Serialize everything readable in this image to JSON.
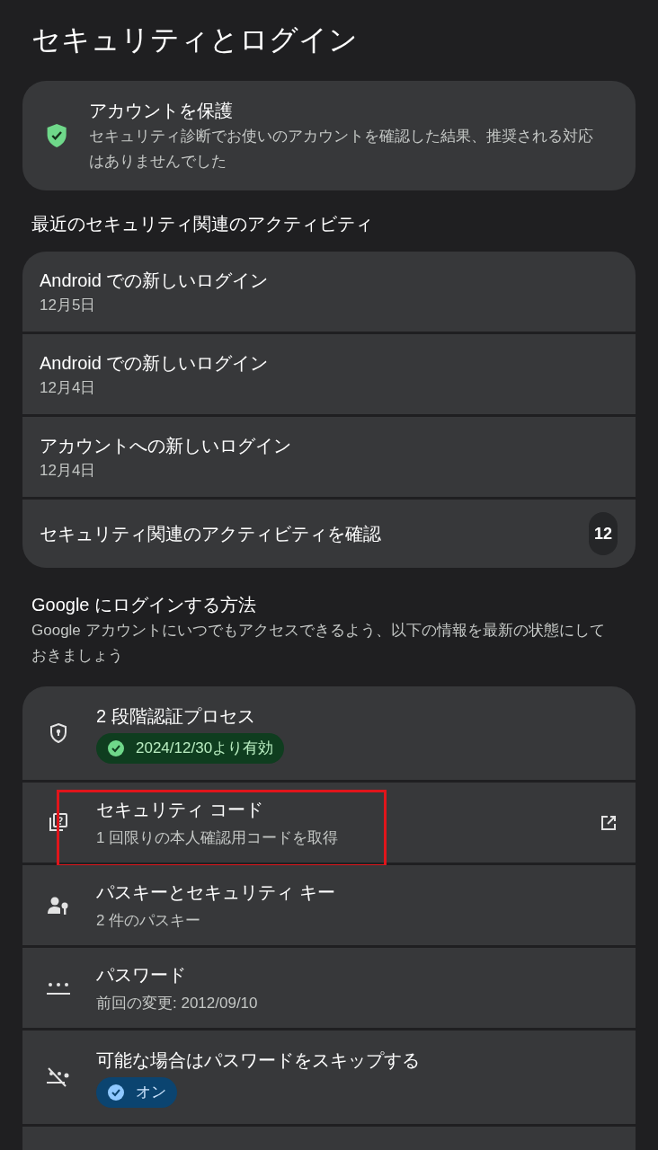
{
  "title": "セキュリティとログイン",
  "protect": {
    "title": "アカウントを保護",
    "description": "セキュリティ診断でお使いのアカウントを確認した結果、推奨される対応はありませんでした"
  },
  "recent": {
    "heading": "最近のセキュリティ関連のアクティビティ",
    "items": [
      {
        "kind": "event",
        "title": "Android での新しいログイン",
        "date": "12月5日"
      },
      {
        "kind": "event",
        "title": "Android での新しいログイン",
        "date": "12月4日"
      },
      {
        "kind": "event",
        "title": "アカウントへの新しいログイン",
        "date": "12月4日"
      },
      {
        "kind": "review",
        "title": "セキュリティ関連のアクティビティを確認",
        "count": "12"
      }
    ]
  },
  "signin": {
    "heading": "Google にログインする方法",
    "description": "Google アカウントにいつでもアクセスできるよう、以下の情報を最新の状態にしておきましょう",
    "items": [
      {
        "kind": "shield-lock",
        "title": "2 段階認証プロセス",
        "badge": {
          "kind": "success",
          "label": "2024/12/30より有効"
        },
        "highlighted": false
      },
      {
        "kind": "code",
        "title": "セキュリティ コード",
        "subtitle": "1 回限りの本人確認用コードを取得",
        "external": true,
        "highlighted": true
      },
      {
        "kind": "passkey",
        "title": "パスキーとセキュリティ キー",
        "subtitle": "2 件のパスキー",
        "highlighted": false
      },
      {
        "kind": "password",
        "title": "パスワード",
        "subtitle": "前回の変更: 2012/09/10",
        "highlighted": false
      },
      {
        "kind": "skip",
        "title": "可能な場合はパスワードをスキップする",
        "badge": {
          "kind": "info",
          "label": "オン"
        },
        "highlighted": false
      }
    ]
  }
}
